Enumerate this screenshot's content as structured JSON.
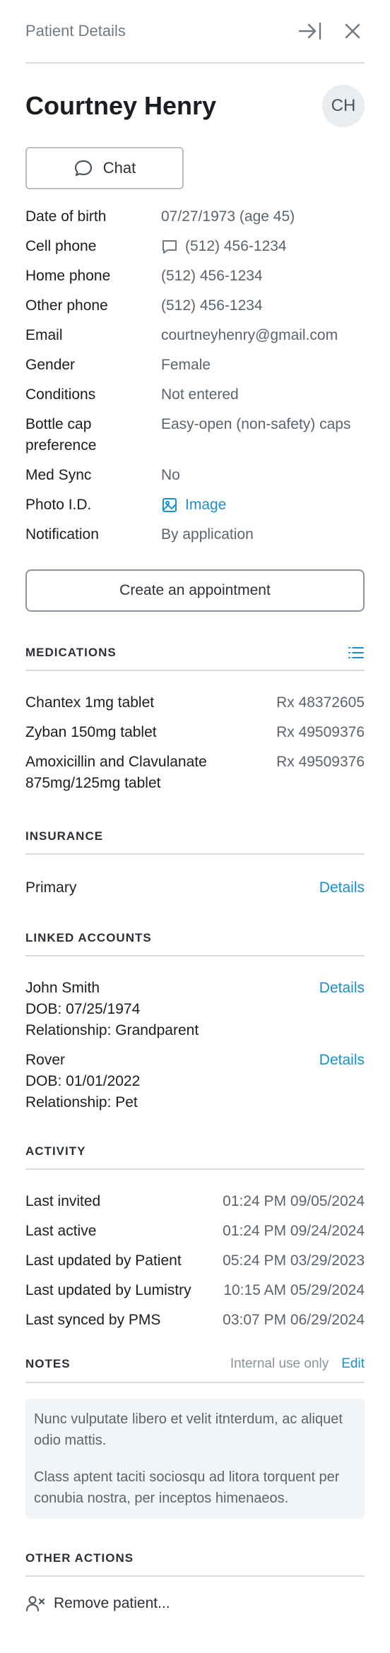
{
  "header": {
    "title": "Patient Details",
    "collapse_icon": "collapse-right-icon",
    "close_icon": "close-icon"
  },
  "patient": {
    "name": "Courtney Henry",
    "initials": "CH"
  },
  "chat_label": "Chat",
  "details": {
    "date_of_birth": {
      "label": "Date of birth",
      "value": "07/27/1973 (age 45)"
    },
    "cell_phone": {
      "label": "Cell phone",
      "value": "(512) 456-1234"
    },
    "home_phone": {
      "label": "Home phone",
      "value": "(512) 456-1234"
    },
    "other_phone": {
      "label": "Other phone",
      "value": "(512) 456-1234"
    },
    "email": {
      "label": "Email",
      "value": "courtneyhenry@gmail.com"
    },
    "gender": {
      "label": "Gender",
      "value": "Female"
    },
    "conditions": {
      "label": "Conditions",
      "value": "Not entered"
    },
    "bottle_cap": {
      "label_1": "Bottle cap",
      "label_2": "preference",
      "value": "Easy-open (non-safety) caps"
    },
    "med_sync": {
      "label": "Med Sync",
      "value": "No"
    },
    "photo_id": {
      "label": "Photo I.D.",
      "value": "Image"
    },
    "notification": {
      "label": "Notification",
      "value": "By application"
    }
  },
  "create_appointment_label": "Create an appointment",
  "medications": {
    "title": "MEDICATIONS",
    "items": [
      {
        "name_1": "Chantex 1mg tablet",
        "name_2": "",
        "rx": "Rx 48372605"
      },
      {
        "name_1": "Zyban 150mg tablet",
        "name_2": "",
        "rx": "Rx 49509376"
      },
      {
        "name_1": "Amoxicillin and Clavulanate",
        "name_2": "875mg/125mg tablet",
        "rx": "Rx 49509376"
      }
    ]
  },
  "insurance": {
    "title": "INSURANCE",
    "primary_label": "Primary",
    "details_label": "Details"
  },
  "linked_accounts": {
    "title": "LINKED ACCOUNTS",
    "items": [
      {
        "name": "John Smith",
        "dob": "DOB: 07/25/1974",
        "relationship": "Relationship: Grandparent",
        "details_label": "Details"
      },
      {
        "name": "Rover",
        "dob": "DOB: 01/01/2022",
        "relationship": "Relationship: Pet",
        "details_label": "Details"
      }
    ]
  },
  "activity": {
    "title": "ACTIVITY",
    "items": [
      {
        "label": "Last invited",
        "value": "01:24 PM 09/05/2024"
      },
      {
        "label": "Last active",
        "value": "01:24 PM 09/24/2024"
      },
      {
        "label": "Last updated by Patient",
        "value": "05:24 PM 03/29/2023"
      },
      {
        "label": "Last updated by Lumistry",
        "value": "10:15 AM 05/29/2024"
      },
      {
        "label": "Last synced by PMS",
        "value": "03:07 PM 06/29/2024"
      }
    ]
  },
  "notes": {
    "title": "NOTES",
    "internal_label": "Internal use only",
    "edit_label": "Edit",
    "paragraphs": [
      "Nunc vulputate libero et velit itnterdum, ac aliquet odio mattis.",
      "Class aptent taciti sociosqu ad litora torquent per conubia nostra, per inceptos himenaeos."
    ]
  },
  "other_actions": {
    "title": "OTHER ACTIONS",
    "remove_label": "Remove patient..."
  },
  "colors": {
    "accent": "#1a8fd1",
    "divider": "#d7dadd",
    "notes_bg": "#f3f6f9"
  }
}
